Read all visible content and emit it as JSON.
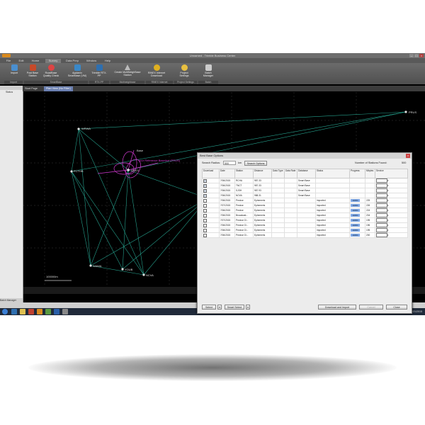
{
  "window": {
    "title": "Unnamed - Trimble Business Center"
  },
  "menu_tabs": [
    "File",
    "Edit",
    "Home",
    "Survey",
    "Data Prep",
    "Window",
    "Help"
  ],
  "ribbon": {
    "buttons": [
      {
        "label": "Import",
        "color": "#4a8fd0"
      },
      {
        "label": "Post Base Station",
        "color": "#c64a2a"
      },
      {
        "label": "RoadBase Quality Check",
        "color": "#d44"
      },
      {
        "label": "Applanix Smartbase (VM)",
        "color": "#3a88c8"
      },
      {
        "label": "Trimble RTX-PP",
        "color": "#2e6fb0"
      },
      {
        "label": "Create MultiNeighBase Station",
        "color": "#999"
      },
      {
        "label": "RINEX Internet Download",
        "color": "#e0b020"
      },
      {
        "label": "Project Settings",
        "color": "#e8c040"
      },
      {
        "label": "Batch Manager",
        "color": "#ccc"
      }
    ],
    "groups": [
      "Import",
      "SmartBase",
      "RTX-PP",
      "Multineighbase",
      "RINEX Internet",
      "Project Settings",
      "Batch"
    ]
  },
  "doc_tabs": [
    {
      "label": "Start Page"
    },
    {
      "label": "Plan View (No Filter)"
    }
  ],
  "sidebar": {
    "header": "",
    "column": "Status",
    "footer": "Batch Manager"
  },
  "map": {
    "stations": [
      {
        "label": "PRUS"
      },
      {
        "label": "WRWA"
      },
      {
        "label": "Base"
      },
      {
        "label": "Your Reference Baseline (PRUS)"
      },
      {
        "label": "GRO1"
      },
      {
        "label": "PCTHB"
      },
      {
        "label": "WAWA"
      },
      {
        "label": "YOUB"
      },
      {
        "label": "NCVA"
      }
    ],
    "scale": "100000m"
  },
  "dialog": {
    "title": "Best Base Options",
    "search_radius_label": "Search Radius:",
    "search_radius_value": "500",
    "search_radius_unit": "km",
    "search_options_label": "Search Options",
    "found_label": "Number of Stations Found:",
    "found_value": "500",
    "columns": [
      "Download",
      "Date",
      "Station",
      "Distance",
      "Data Type",
      "Data Rate",
      "Database",
      "Status",
      "Progress",
      "Mbytes",
      "Service"
    ],
    "rows": [
      {
        "checked": true,
        "date": "7/06/2015",
        "station": "RCHA",
        "distance": "987.33",
        "data_type": "",
        "data_rate": "",
        "database": "Smart Base",
        "status": "",
        "progress": "",
        "mbytes": "",
        "service": ""
      },
      {
        "checked": true,
        "date": "7/06/2015",
        "station": "TNCT",
        "distance": "987.33",
        "data_type": "",
        "data_rate": "",
        "database": "Smart Base",
        "status": "",
        "progress": "",
        "mbytes": "",
        "service": ""
      },
      {
        "checked": true,
        "date": "7/06/2015",
        "station": "SJSH",
        "distance": "987.93",
        "data_type": "",
        "data_rate": "",
        "database": "Smart Base",
        "status": "",
        "progress": "",
        "mbytes": "",
        "service": ""
      },
      {
        "checked": true,
        "date": "7/06/2015",
        "station": "NOVA",
        "distance": "988.31",
        "data_type": "",
        "data_rate": "",
        "database": "Smart Base",
        "status": "",
        "progress": "",
        "mbytes": "",
        "service": ""
      },
      {
        "checked": false,
        "date": "7/06/2015",
        "station": "Precise",
        "distance": "Ephemeris",
        "data_type": "",
        "data_rate": "",
        "database": "",
        "status": "Imported",
        "progress": "100%",
        "mbytes": "225",
        "service": ""
      },
      {
        "checked": false,
        "date": "7/07/2015",
        "station": "Precise",
        "distance": "Ephemeris",
        "data_type": "",
        "data_rate": "",
        "database": "",
        "status": "Imported",
        "progress": "100%",
        "mbytes": "226",
        "service": ""
      },
      {
        "checked": false,
        "date": "7/06/2015",
        "station": "Precise",
        "distance": "Ephemeris",
        "data_type": "",
        "data_rate": "",
        "database": "",
        "status": "Imported",
        "progress": "100%",
        "mbytes": "224",
        "service": ""
      },
      {
        "checked": false,
        "date": "7/06/2015",
        "station": "Broadcast...",
        "distance": "Ephemeris",
        "data_type": "",
        "data_rate": "",
        "database": "",
        "status": "Imported",
        "progress": "100%",
        "mbytes": "204",
        "service": ""
      },
      {
        "checked": false,
        "date": "7/07/2015",
        "station": "Precise Gl...",
        "distance": "Ephemeris",
        "data_type": "",
        "data_rate": "",
        "database": "",
        "status": "Imported",
        "progress": "100%",
        "mbytes": "195",
        "service": ""
      },
      {
        "checked": false,
        "date": "7/06/2015",
        "station": "Precise Gl...",
        "distance": "Ephemeris",
        "data_type": "",
        "data_rate": "",
        "database": "",
        "status": "Imported",
        "progress": "100%",
        "mbytes": "196",
        "service": ""
      },
      {
        "checked": false,
        "date": "7/06/2015",
        "station": "Precise Gl...",
        "distance": "Ephemeris",
        "data_type": "",
        "data_rate": "",
        "database": "",
        "status": "Imported",
        "progress": "100%",
        "mbytes": "195",
        "service": ""
      },
      {
        "checked": false,
        "date": "7/06/2015",
        "station": "Precise Gl...",
        "distance": "Ephemeris",
        "data_type": "",
        "data_rate": "",
        "database": "",
        "status": "Imported",
        "progress": "100%",
        "mbytes": "200",
        "service": ""
      }
    ],
    "select_label": "Select",
    "smart_select_label": "Smart Select",
    "download_import_label": "Download and Import",
    "cancel_label": "Cancel",
    "close_label": "Close"
  },
  "statusbar": {
    "text": "Snap  Plane  Grid"
  },
  "tray": {
    "text": "2:08 PM  7/21/2015"
  },
  "colors": {
    "station_line": "#2fc9b0",
    "magenta": "#d23ad2",
    "accent": "#6a7fb0"
  }
}
